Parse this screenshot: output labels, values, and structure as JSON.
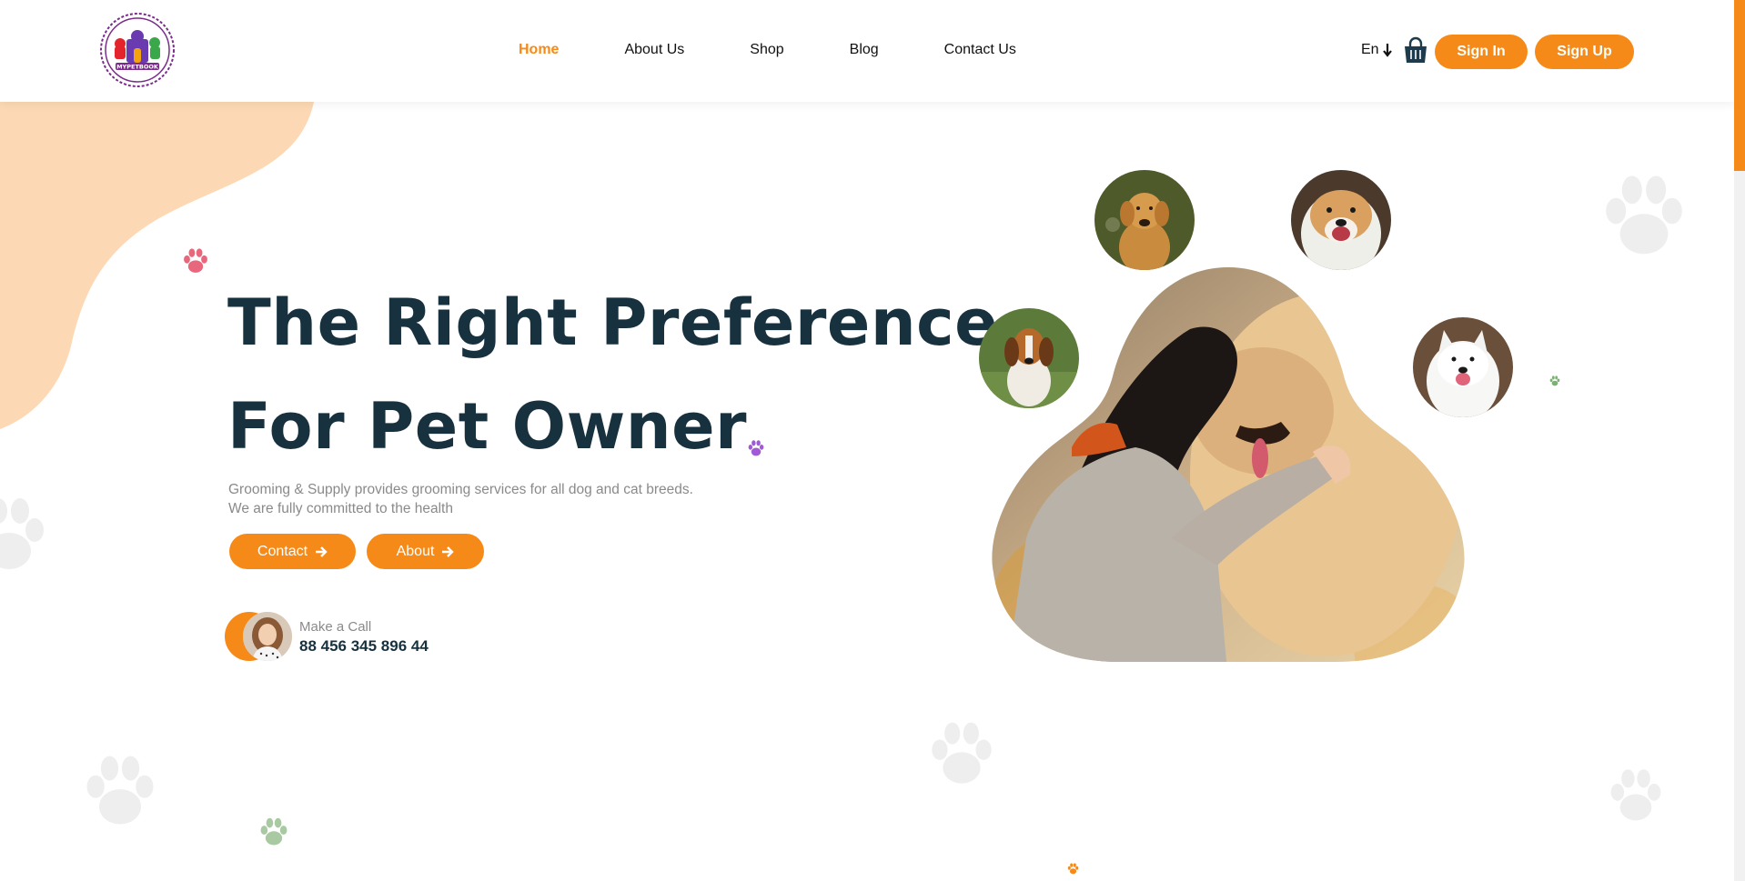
{
  "header": {
    "logo_text": "MYPETBOOK",
    "nav": [
      {
        "label": "Home",
        "active": true
      },
      {
        "label": "About Us",
        "active": false
      },
      {
        "label": "Shop",
        "active": false
      },
      {
        "label": "Blog",
        "active": false
      },
      {
        "label": "Contact Us",
        "active": false
      }
    ],
    "language": "En",
    "cart_icon": "shopping-basket-icon",
    "sign_in": "Sign In",
    "sign_up": "Sign Up"
  },
  "hero": {
    "title_line1": "The Right Preference",
    "title_line2": "For Pet Owner",
    "description_line1": "Grooming & Supply provides grooming services for all dog and cat breeds.",
    "description_line2": "We are fully committed to the health",
    "contact_button": "Contact",
    "about_button": "About",
    "call_label": "Make a Call",
    "call_phone": "88 456 345 896 44"
  },
  "colors": {
    "accent": "#f58a18",
    "heading": "#17313f",
    "blob": "#fcd9b4",
    "paw_grey": "#eeeeee",
    "paw_pink": "#e8677c",
    "paw_purple": "#a05ad6",
    "paw_green": "#7bb173"
  }
}
